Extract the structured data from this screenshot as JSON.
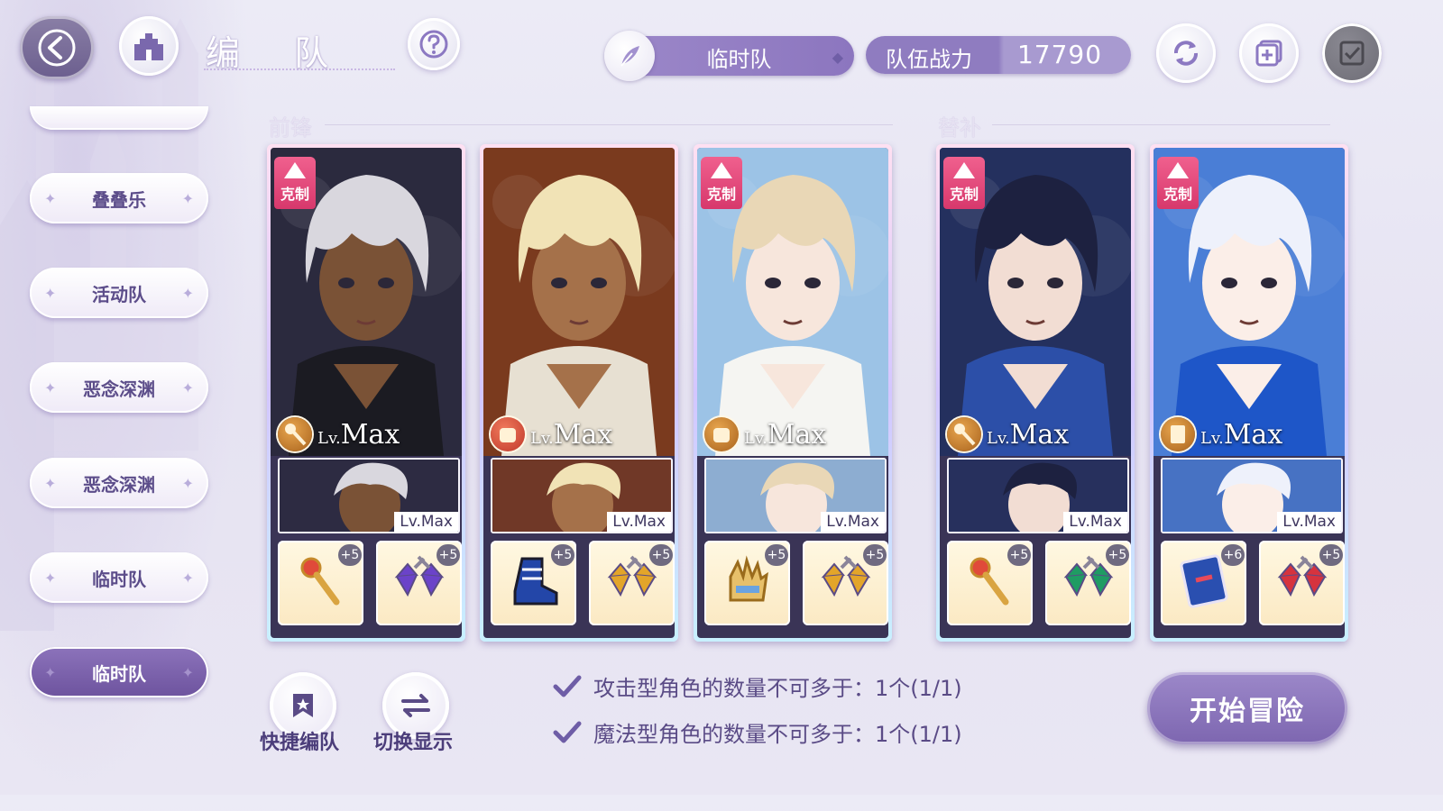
{
  "header": {
    "title": "编 队",
    "team_name": "临时队",
    "power_label": "队伍战力",
    "power_value": "17790"
  },
  "icons": {
    "back": "back-arrow-icon",
    "home": "castle-home-icon",
    "help": "question-icon",
    "feather": "feather-icon",
    "refresh": "refresh-icon",
    "add": "add-square-icon",
    "confirm": "checkbox-icon"
  },
  "sidebar": {
    "items": [
      {
        "label": "叠叠乐",
        "active": false
      },
      {
        "label": "活动队",
        "active": false
      },
      {
        "label": "恶念深渊",
        "active": false
      },
      {
        "label": "恶念深渊",
        "active": false
      },
      {
        "label": "临时队",
        "active": false
      },
      {
        "label": "临时队",
        "active": true
      }
    ]
  },
  "sections": {
    "front": "前锋",
    "sub": "替补"
  },
  "cards": [
    {
      "restrain": "克制",
      "lv_prefix": "Lv.",
      "lv": "Max",
      "class": "staff",
      "support_lv": "Lv.Max",
      "equip": [
        {
          "item": "staff",
          "plus": "+5"
        },
        {
          "item": "purple-gem-ring",
          "plus": "+5"
        }
      ],
      "colors": {
        "bg": "#2b2a3e",
        "hair": "#d9d7de",
        "skin": "#7a5236",
        "cloth": "#1b1b22"
      }
    },
    {
      "restrain": "",
      "lv_prefix": "Lv.",
      "lv": "Max",
      "class": "fist",
      "support_lv": "Lv.Max",
      "equip": [
        {
          "item": "boot",
          "plus": "+5"
        },
        {
          "item": "gold-gem-ring",
          "plus": "+5"
        }
      ],
      "colors": {
        "bg": "#7a3a1e",
        "hair": "#f1e3b6",
        "skin": "#a5714a",
        "cloth": "#e7e0d2"
      }
    },
    {
      "restrain": "克制",
      "lv_prefix": "Lv.",
      "lv": "Max",
      "class": "fist",
      "support_lv": "Lv.Max",
      "equip": [
        {
          "item": "gauntlet",
          "plus": "+5"
        },
        {
          "item": "gold-gem-ring",
          "plus": "+5"
        }
      ],
      "colors": {
        "bg": "#9cc3e6",
        "hair": "#e9d7b6",
        "skin": "#f7e6dc",
        "cloth": "#f5f5f2"
      }
    },
    {
      "restrain": "克制",
      "lv_prefix": "Lv.",
      "lv": "Max",
      "class": "staff",
      "support_lv": "Lv.Max",
      "equip": [
        {
          "item": "staff",
          "plus": "+5"
        },
        {
          "item": "green-gem-ring",
          "plus": "+5"
        }
      ],
      "colors": {
        "bg": "#24305e",
        "hair": "#1d2140",
        "skin": "#f2ddd3",
        "cloth": "#2c4fa8"
      }
    },
    {
      "restrain": "克制",
      "lv_prefix": "Lv.",
      "lv": "Max",
      "class": "book",
      "support_lv": "Lv.Max",
      "equip": [
        {
          "item": "tome",
          "plus": "+6"
        },
        {
          "item": "red-gem-ring",
          "plus": "+5"
        }
      ],
      "colors": {
        "bg": "#4a7ed6",
        "hair": "#eef1fb",
        "skin": "#fbeee8",
        "cloth": "#1e56c8"
      }
    }
  ],
  "bottom": {
    "quick_label": "快捷编队",
    "switch_label": "切换显示",
    "rules": [
      "攻击型角色的数量不可多于：1个(1/1)",
      "魔法型角色的数量不可多于：1个(1/1)"
    ],
    "start_label": "开始冒险"
  },
  "colors": {
    "accent": "#8c76bf",
    "restrain": "#e24877",
    "active_sidebar": "#7b62ab"
  }
}
